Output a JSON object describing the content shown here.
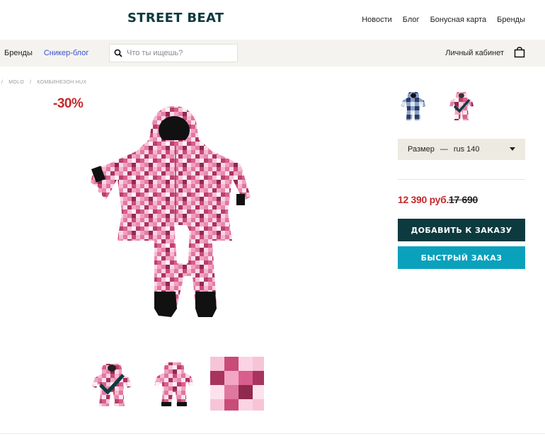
{
  "header": {
    "logo": "STREET BEAT",
    "nav": [
      "Новости",
      "Блог",
      "Бонусная карта",
      "Бренды"
    ]
  },
  "subnav": {
    "brands": "Бренды",
    "sneaker_blog": "Сникер-блог",
    "search_placeholder": "Что ты ищешь?",
    "cabinet": "Личный кабинет"
  },
  "breadcrumb": [
    "/",
    "MOLO",
    "/",
    "КОМБИНЕЗОН HUX"
  ],
  "product": {
    "discount": "-30%",
    "size_label": "Размер",
    "size_dash": "—",
    "size_value": "rus 140",
    "price": "12 390 руб.",
    "old_price": "17 690",
    "add_button": "ДОБАВИТЬ К ЗАКАЗУ",
    "quick_button": "БЫСТРЫЙ ЗАКАЗ"
  },
  "colors": {
    "brand_dark": "#0d3a3f",
    "accent_cyan": "#0aa1bd",
    "sale_red": "#c62828",
    "link_blue": "#3b4fd0"
  }
}
